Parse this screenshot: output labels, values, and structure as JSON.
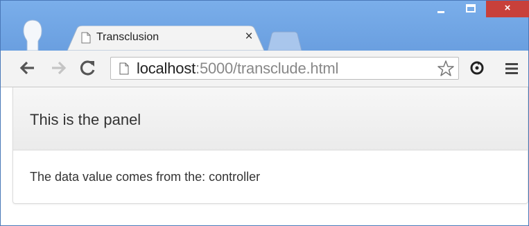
{
  "window": {
    "minimize_label": "–",
    "maximize_label": "☐",
    "close_label": "×"
  },
  "tab": {
    "title": "Transclusion",
    "close_label": "×"
  },
  "toolbar": {
    "url_host": "localhost",
    "url_rest": ":5000/transclude.html"
  },
  "icons": {
    "back": "back-arrow-icon",
    "forward": "forward-arrow-icon",
    "reload": "reload-icon",
    "page": "page-icon",
    "bookmark": "star-icon",
    "extension": "extension-icon",
    "menu": "menu-icon"
  },
  "colors": {
    "titlebar": "#6fa0e0",
    "close_button": "#c8403a",
    "toolbar": "#f3f3f3",
    "panel_heading": "#f2f2f2"
  },
  "panel": {
    "heading": "This is the panel",
    "body": "The data value comes from the: controller"
  }
}
